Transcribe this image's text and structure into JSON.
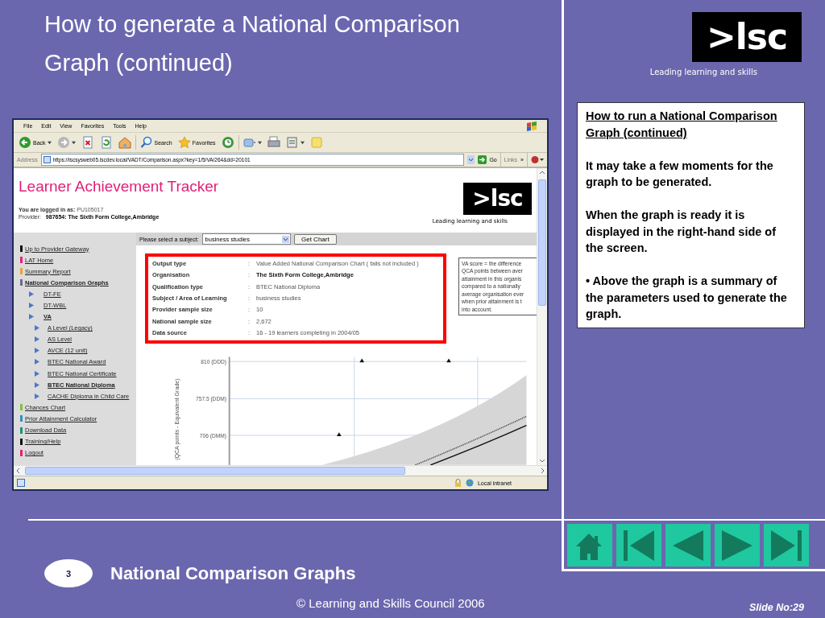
{
  "slide": {
    "title": "How to generate a National Comparison Graph (continued)",
    "logo": {
      "text": ">lsc",
      "tagline": "Leading learning and skills"
    }
  },
  "browser": {
    "menu": [
      "File",
      "Edit",
      "View",
      "Favorites",
      "Tools",
      "Help"
    ],
    "toolbar": [
      {
        "kind": "back",
        "label": "Back"
      },
      {
        "kind": "forward"
      },
      {
        "kind": "stop"
      },
      {
        "kind": "refresh"
      },
      {
        "kind": "home"
      },
      {
        "kind": "search",
        "label": "Search"
      },
      {
        "kind": "favorites",
        "label": "Favorites"
      },
      {
        "kind": "history"
      },
      {
        "kind": "mail"
      },
      {
        "kind": "print"
      },
      {
        "kind": "edit"
      },
      {
        "kind": "note"
      }
    ],
    "address": {
      "label": "Address",
      "value": "https://lscsysweb05.lscdev.local/VADT/Comparison.aspx?key=1/5/VA/264&dd=20101",
      "go": "Go",
      "links": "Links",
      "more": "»"
    },
    "status": {
      "zone": "Local intranet"
    }
  },
  "page": {
    "title": "Learner Achievement Tracker",
    "login_label": "You are logged in as:",
    "login_user": "PU105017",
    "provider_label": "Provider:",
    "provider": "987654: The Sixth Form College,Ambridge",
    "logo": {
      "text": ">lsc",
      "tagline": "Leading learning and skills"
    },
    "nav": [
      {
        "label": "Up to Provider Gateway",
        "color": "#111111",
        "selected": false
      },
      {
        "label": "LAT Home",
        "color": "#e8207a",
        "selected": false
      },
      {
        "label": "Summary Report",
        "color": "#f0a030",
        "selected": false
      },
      {
        "label": "National Comparison Graphs",
        "color": "#6a6a90",
        "selected": true,
        "children": [
          {
            "label": "DT-FE",
            "selected": false
          },
          {
            "label": "DT-WBL",
            "selected": false
          },
          {
            "label": "VA",
            "selected": true,
            "children": [
              {
                "label": "A Level (Legacy)",
                "selected": false
              },
              {
                "label": "AS Level",
                "selected": false
              },
              {
                "label": "AVCE (12 unit)",
                "selected": false
              },
              {
                "label": "BTEC National Award",
                "selected": false
              },
              {
                "label": "BTEC National Certificate",
                "selected": false
              },
              {
                "label": "BTEC National Diploma",
                "selected": true
              },
              {
                "label": "CACHE Diploma in Child Care",
                "selected": false
              }
            ]
          }
        ]
      },
      {
        "label": "Chances Chart",
        "color": "#80c040",
        "selected": false
      },
      {
        "label": "Prior Attainment Calculator",
        "color": "#3090c0",
        "selected": false
      },
      {
        "label": "Download Data",
        "color": "#209080",
        "selected": false
      },
      {
        "label": "Training/Help",
        "color": "#111111",
        "selected": false
      },
      {
        "label": "Logout",
        "color": "#e8207a",
        "selected": false
      }
    ],
    "subject": {
      "label": "Please select a subject:",
      "value": "business studies",
      "button": "Get Chart"
    },
    "summary": [
      {
        "label": "Output type",
        "separator": ":",
        "value": "Value Added National Comparison Chart ( fails not included )",
        "bold": false
      },
      {
        "label": "Organisation",
        "separator": ":",
        "value": "The Sixth Form College,Ambridge",
        "bold": true
      },
      {
        "label": "Qualification type",
        "separator": ":",
        "value": "BTEC National Diploma",
        "bold": false
      },
      {
        "label": "Subject / Area of Learning",
        "separator": ":",
        "value": "business studies",
        "bold": false
      },
      {
        "label": "Provider sample size",
        "separator": ":",
        "value": "10",
        "bold": false
      },
      {
        "label": "National sample size",
        "separator": ":",
        "value": "2,672",
        "bold": false
      },
      {
        "label": "Data source",
        "separator": ":",
        "value": "16 - 19 learners completing in 2004/05",
        "bold": false
      }
    ],
    "note": [
      "VA score = the difference",
      "QCA points between aver",
      "attainment in this organis",
      "compared to a nationally",
      "average organisation ever",
      "when prior attainment is t",
      "into account."
    ],
    "chart": {
      "ylabel": "(QCA points - Equivalent Grade)",
      "yticks": [
        "810 (DDD)",
        "757.5 (DDM)",
        "706 (DMM)"
      ]
    }
  },
  "notes": {
    "heading": "How to run a National Comparison Graph (continued)",
    "paragraphs": [
      "It may take a few moments for the graph to be generated.",
      "When the graph is ready it is displayed in the right-hand side of the screen.",
      "• Above the graph is a summary of the parameters used to generate the graph."
    ]
  },
  "footer": {
    "section_number": "3",
    "section_title": "National Comparison Graphs",
    "copyright": "© Learning and Skills Council 2006",
    "slide_number": "Slide No:29"
  }
}
